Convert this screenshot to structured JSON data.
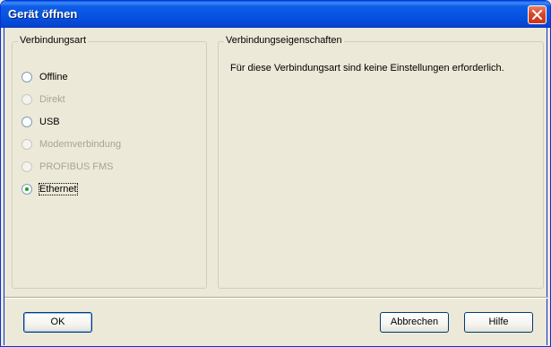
{
  "window": {
    "title": "Gerät öffnen"
  },
  "connection_type": {
    "legend": "Verbindungsart",
    "options": [
      {
        "label": "Offline",
        "enabled": true,
        "selected": false
      },
      {
        "label": "Direkt",
        "enabled": false,
        "selected": false
      },
      {
        "label": "USB",
        "enabled": true,
        "selected": false
      },
      {
        "label": "Modemverbindung",
        "enabled": false,
        "selected": false
      },
      {
        "label": "PROFIBUS FMS",
        "enabled": false,
        "selected": false
      },
      {
        "label": "Ethernet",
        "enabled": true,
        "selected": true
      }
    ]
  },
  "properties": {
    "legend": "Verbindungseigenschaften",
    "message": "Für diese Verbindungsart sind keine Einstellungen erforderlich."
  },
  "buttons": {
    "ok": "OK",
    "cancel": "Abbrechen",
    "help": "Hilfe"
  },
  "colors": {
    "titlebar": "#0553e1",
    "dialog_bg": "#ece9d8",
    "close_button": "#d8472a",
    "disabled_text": "#a6a598",
    "radio_selected": "#21a121"
  }
}
